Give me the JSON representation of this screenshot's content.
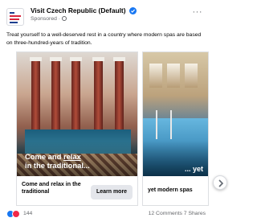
{
  "post": {
    "page_name": "Visit Czech Republic (Default)",
    "sponsored": "Sponsored ·",
    "more_label": "···",
    "caption": "Treat yourself to a well-deserved rest in a country where modern spas are based on three-hundred-years of tradition.",
    "verified_icon": "verified-badge-icon",
    "privacy_icon": "globe-icon"
  },
  "carousel": {
    "cards": [
      {
        "overlay_prefix": "Come and ",
        "overlay_emphasis": "relax",
        "overlay_suffix": "in the traditional...",
        "title": "Come and relax in the traditional",
        "button": "Learn more"
      },
      {
        "overlay": "... yet",
        "title": "yet modern spas"
      }
    ],
    "next_icon": "chevron-right-icon"
  },
  "footer": {
    "reaction_count": "144",
    "engagement": "12 Comments  7 Shares",
    "reaction_icons": [
      "like-icon",
      "love-icon"
    ]
  },
  "colors": {
    "accent": "#1877f2",
    "love": "#f02849",
    "button_bg": "#e4e6eb"
  }
}
